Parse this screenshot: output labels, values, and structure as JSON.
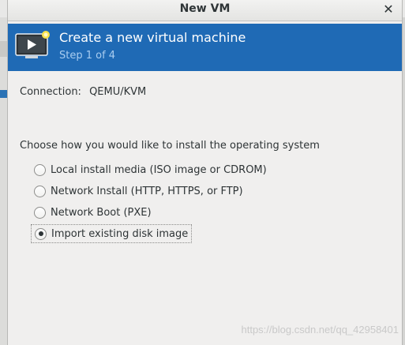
{
  "window": {
    "title": "New VM",
    "close_glyph": "✕"
  },
  "header": {
    "title": "Create a new virtual machine",
    "step": "Step 1 of 4",
    "icon": "monitor-new-vm-icon",
    "accent_color": "#1f6ab5"
  },
  "connection": {
    "label": "Connection:",
    "value": "QEMU/KVM"
  },
  "install": {
    "prompt": "Choose how you would like to install the operating system",
    "options": [
      {
        "label": "Local install media (ISO image or CDROM)",
        "selected": false
      },
      {
        "label": "Network Install (HTTP, HTTPS, or FTP)",
        "selected": false
      },
      {
        "label": "Network Boot (PXE)",
        "selected": false
      },
      {
        "label": "Import existing disk image",
        "selected": true
      }
    ]
  },
  "watermark": "https://blog.csdn.net/qq_42958401"
}
